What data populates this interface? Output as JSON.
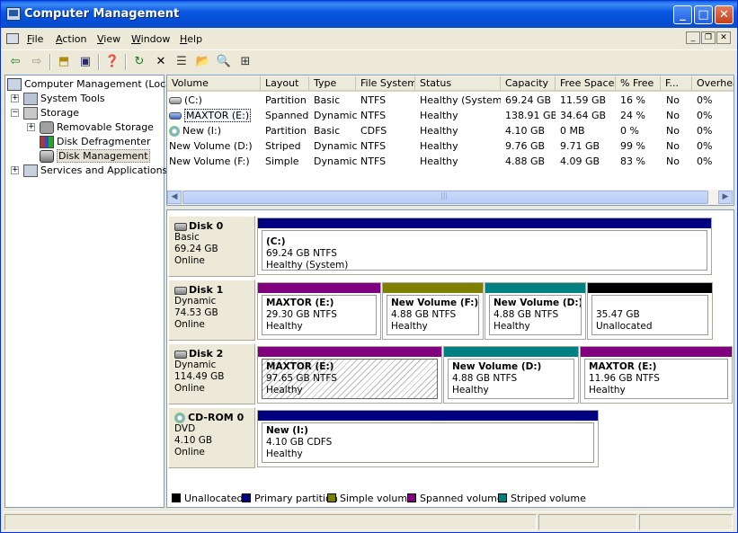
{
  "window": {
    "title": "Computer Management"
  },
  "menu": {
    "items": [
      "File",
      "Action",
      "View",
      "Window",
      "Help"
    ]
  },
  "toolbar": {
    "icons": [
      "back-arrow-icon",
      "forward-arrow-icon",
      "up-folder-icon",
      "show-hide-tree-icon",
      "properties-icon",
      "refresh-icon",
      "delete-icon",
      "properties-sheet-icon",
      "open-icon",
      "search-icon",
      "disk-view-icon"
    ]
  },
  "tree": {
    "root": "Computer Management (Local)",
    "system_tools": "System Tools",
    "storage": "Storage",
    "removable_storage": "Removable Storage",
    "disk_defragmenter": "Disk Defragmenter",
    "disk_management": "Disk Management",
    "services": "Services and Applications"
  },
  "volumes": {
    "columns": [
      "Volume",
      "Layout",
      "Type",
      "File System",
      "Status",
      "Capacity",
      "Free Space",
      "% Free",
      "F...",
      "Overhead"
    ],
    "rows": [
      [
        "(C:)",
        "Partition",
        "Basic",
        "NTFS",
        "Healthy (System)",
        "69.24 GB",
        "11.59 GB",
        "16 %",
        "No",
        "0%"
      ],
      [
        "MAXTOR (E:)",
        "Spanned",
        "Dynamic",
        "NTFS",
        "Healthy",
        "138.91 GB",
        "34.64 GB",
        "24 %",
        "No",
        "0%"
      ],
      [
        "New (I:)",
        "Partition",
        "Basic",
        "CDFS",
        "Healthy",
        "4.10 GB",
        "0 MB",
        "0 %",
        "No",
        "0%"
      ],
      [
        "New Volume (D:)",
        "Striped",
        "Dynamic",
        "NTFS",
        "Healthy",
        "9.76 GB",
        "9.71 GB",
        "99 %",
        "No",
        "0%"
      ],
      [
        "New Volume (F:)",
        "Simple",
        "Dynamic",
        "NTFS",
        "Healthy",
        "4.88 GB",
        "4.09 GB",
        "83 %",
        "No",
        "0%"
      ]
    ]
  },
  "disks": [
    {
      "name": "Disk 0",
      "type": "Basic",
      "size": "69.24 GB",
      "status": "Online",
      "partitions": [
        {
          "name": "(C:)",
          "size": "69.24 GB NTFS",
          "status": "Healthy (System)",
          "kind": "primary"
        }
      ]
    },
    {
      "name": "Disk 1",
      "type": "Dynamic",
      "size": "74.53 GB",
      "status": "Online",
      "partitions": [
        {
          "name": "MAXTOR  (E:)",
          "size": "29.30 GB NTFS",
          "status": "Healthy",
          "kind": "spanned"
        },
        {
          "name": "New Volume  (F:)",
          "size": "4.88 GB NTFS",
          "status": "Healthy",
          "kind": "simple"
        },
        {
          "name": "New Volume  (D:)",
          "size": "4.88 GB NTFS",
          "status": "Healthy",
          "kind": "striped"
        },
        {
          "name": "",
          "size": "35.47 GB",
          "status": "Unallocated",
          "kind": "unallocated"
        }
      ]
    },
    {
      "name": "Disk 2",
      "type": "Dynamic",
      "size": "114.49 GB",
      "status": "Online",
      "partitions": [
        {
          "name": "MAXTOR  (E:)",
          "size": "97.65 GB NTFS",
          "status": "Healthy",
          "kind": "spanned"
        },
        {
          "name": "New Volume  (D:)",
          "size": "4.88 GB NTFS",
          "status": "Healthy",
          "kind": "striped"
        },
        {
          "name": "MAXTOR  (E:)",
          "size": "11.96 GB NTFS",
          "status": "Healthy",
          "kind": "spanned"
        }
      ]
    },
    {
      "name": "CD-ROM 0",
      "type": "DVD",
      "size": "4.10 GB",
      "status": "Online",
      "partitions": [
        {
          "name": "New  (I:)",
          "size": "4.10 GB CDFS",
          "status": "Healthy",
          "kind": "primary"
        }
      ]
    }
  ],
  "legend": [
    {
      "label": "Unallocated",
      "color": "#000000"
    },
    {
      "label": "Primary partition",
      "color": "#000080"
    },
    {
      "label": "Simple volume",
      "color": "#808000"
    },
    {
      "label": "Spanned volume",
      "color": "#800080"
    },
    {
      "label": "Striped volume",
      "color": "#008080"
    }
  ]
}
